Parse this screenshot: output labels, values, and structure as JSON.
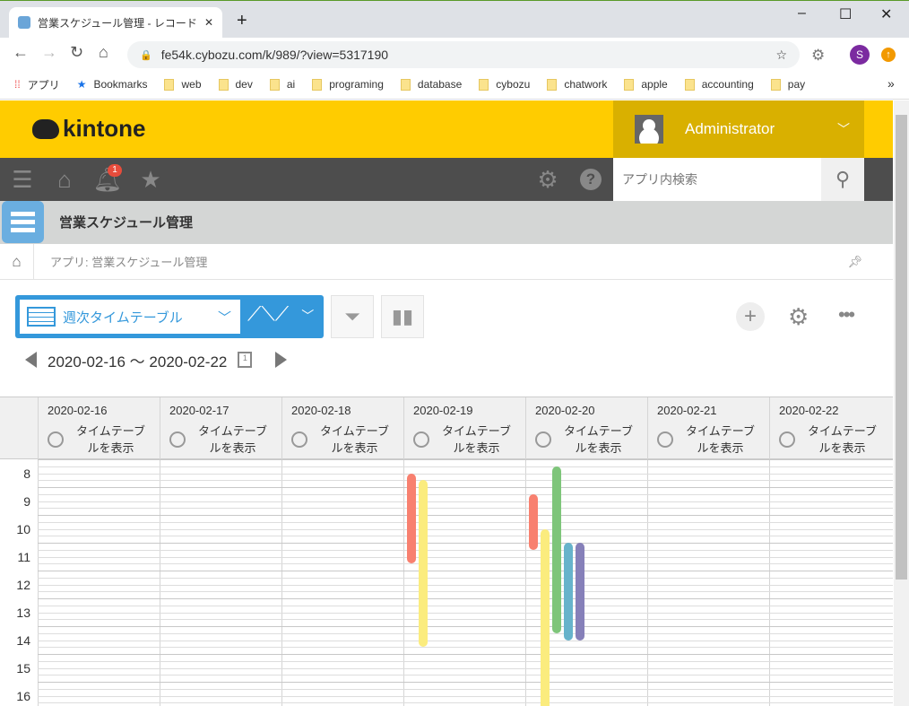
{
  "browser": {
    "tab_title": "営業スケジュール管理 - レコードの一覧",
    "url": "fe54k.cybozu.com/k/989/?view=5317190",
    "profile_initial": "S",
    "bookmarks": [
      "アプリ",
      "Bookmarks",
      "web",
      "dev",
      "ai",
      "programing",
      "database",
      "cybozu",
      "chatwork",
      "apple",
      "accounting",
      "pay"
    ]
  },
  "header": {
    "logo": "kintone",
    "user": "Administrator",
    "notification_count": "1",
    "search_placeholder": "アプリ内検索"
  },
  "app": {
    "title": "営業スケジュール管理",
    "breadcrumb": "アプリ: 営業スケジュール管理"
  },
  "view": {
    "selected": "週次タイムテーブル",
    "date_range": "2020-02-16 〜 2020-02-22"
  },
  "timetable": {
    "days": [
      "2020-02-16",
      "2020-02-17",
      "2020-02-18",
      "2020-02-19",
      "2020-02-20",
      "2020-02-21",
      "2020-02-22"
    ],
    "show_timetable_label": [
      "タイムテーブ",
      "ルを表示"
    ],
    "hours": [
      "8",
      "9",
      "10",
      "11",
      "12",
      "13",
      "14",
      "15",
      "16"
    ],
    "events": [
      {
        "day": 3,
        "lane": 0,
        "start": 8.5,
        "end": 11.75,
        "color": "#f8806f"
      },
      {
        "day": 3,
        "lane": 1,
        "start": 8.75,
        "end": 14.75,
        "color": "#fbec7e"
      },
      {
        "day": 4,
        "lane": 0,
        "start": 9.25,
        "end": 11.25,
        "color": "#f8806f"
      },
      {
        "day": 4,
        "lane": 1,
        "start": 10.5,
        "end": 18,
        "color": "#fbec7e"
      },
      {
        "day": 4,
        "lane": 2,
        "start": 8.25,
        "end": 14.25,
        "color": "#7ec57a"
      },
      {
        "day": 4,
        "lane": 3,
        "start": 11,
        "end": 14.5,
        "color": "#67b3cb"
      },
      {
        "day": 4,
        "lane": 4,
        "start": 11,
        "end": 14.5,
        "color": "#8680b9"
      }
    ]
  },
  "colors": {
    "brand": "#ffcc00",
    "admin": "#d9b000",
    "nav": "#4d4d4d",
    "accent": "#3498db"
  }
}
